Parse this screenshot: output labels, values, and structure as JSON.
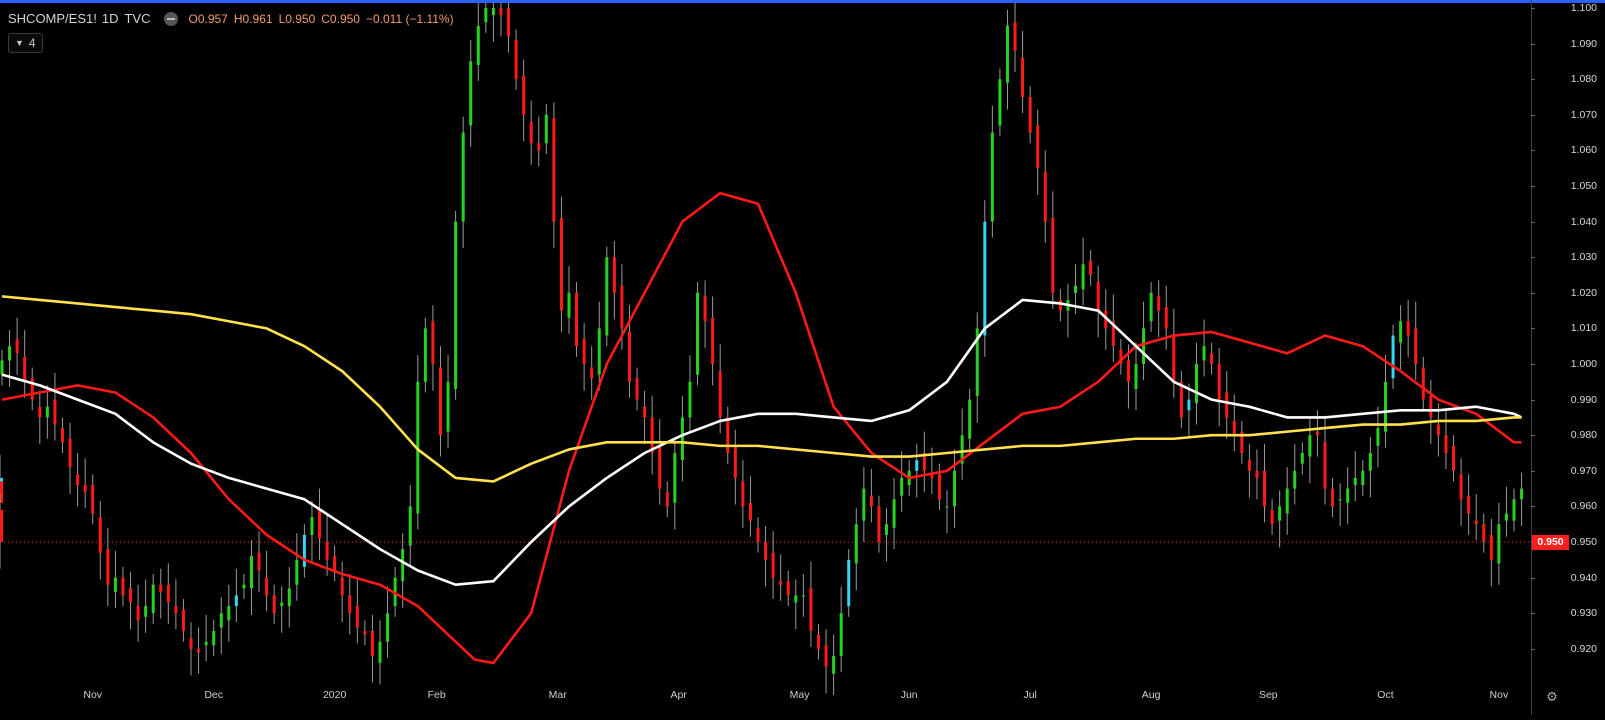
{
  "legend": {
    "symbol": "SHCOMP/ES1!",
    "interval": "1D",
    "source": "TVC",
    "open": "O0.957",
    "high": "H0.961",
    "low": "L0.950",
    "close": "C0.950",
    "change": "−0.011 (−1.11%)",
    "collapsed_count": "4"
  },
  "last_price_label": "0.950",
  "colors": {
    "background": "#000000",
    "up": "#25d31e",
    "down": "#ff1a1a",
    "up_hollow_cyan": "#33d6f5",
    "ma_red": "#ff1a1a",
    "ma_white": "#ffffff",
    "ma_yellow": "#ffe14d",
    "price_line": "#ff1a1a"
  },
  "icons": {
    "visibility": "eye-icon",
    "collapse": "chevron-down-icon",
    "settings": "gear-icon"
  },
  "chart_data": {
    "type": "line",
    "title": "SHCOMP/ES1!",
    "xlabel": "",
    "ylabel": "",
    "y_ticks": [
      "1.100",
      "1.090",
      "1.080",
      "1.070",
      "1.060",
      "1.050",
      "1.040",
      "1.030",
      "1.020",
      "1.010",
      "1.000",
      "0.990",
      "0.980",
      "0.970",
      "0.960",
      "0.950",
      "0.940",
      "0.930",
      "0.920"
    ],
    "x_ticks": [
      "Nov",
      "Dec",
      "2020",
      "Feb",
      "Mar",
      "Apr",
      "May",
      "Jun",
      "Jul",
      "Aug",
      "Sep",
      "Oct",
      "Nov"
    ],
    "ylim": [
      0.913,
      1.1
    ],
    "last_price": 0.95,
    "grid": false,
    "candles": {
      "x": [
        0,
        2,
        4,
        6,
        8,
        10,
        12,
        14,
        16,
        18,
        20,
        22,
        24,
        26,
        28,
        30,
        32,
        34,
        36,
        38,
        40,
        42,
        44,
        46,
        48,
        50,
        52,
        54,
        56,
        58,
        60,
        62,
        64,
        66,
        68,
        70,
        72,
        74,
        76,
        78,
        80,
        82,
        84,
        86,
        88,
        90,
        92,
        94,
        96,
        98,
        100,
        102,
        104,
        106,
        108,
        110,
        112,
        114,
        116,
        118,
        120,
        122,
        124,
        126,
        128,
        130,
        132,
        134,
        136,
        138,
        140,
        142,
        144,
        146,
        148,
        150,
        152,
        154,
        156,
        158,
        160,
        162,
        164,
        166,
        168,
        170,
        172,
        174,
        176,
        178,
        180,
        182,
        184,
        186,
        188,
        190,
        192,
        194,
        196,
        198,
        200,
        202,
        204,
        206,
        208,
        210,
        212,
        214,
        216,
        218,
        220,
        222,
        224,
        226,
        228,
        230,
        232,
        234,
        236,
        238,
        240,
        242,
        244,
        246,
        248,
        250,
        252,
        254,
        256,
        258,
        260,
        262,
        264,
        266,
        268,
        270,
        272,
        274,
        276,
        278,
        280,
        282,
        284,
        286,
        288,
        290,
        292,
        294,
        296,
        298,
        300,
        302,
        304,
        306,
        308,
        310,
        312,
        314,
        316,
        318,
        320,
        322,
        324,
        326,
        328,
        330,
        332,
        334,
        336,
        338,
        340,
        342,
        344,
        346,
        348,
        350,
        352,
        354,
        356,
        358,
        360,
        362,
        364,
        366,
        368,
        370,
        372,
        374,
        376,
        378,
        380,
        382,
        384,
        386,
        388,
        390,
        392,
        394,
        396,
        398,
        400,
        402
      ],
      "close": [
        1.001,
        1.005,
        1.003,
        0.995,
        0.99,
        0.985,
        0.988,
        0.983,
        0.978,
        0.971,
        0.966,
        0.964,
        0.958,
        0.947,
        0.938,
        0.94,
        0.935,
        0.933,
        0.928,
        0.932,
        0.938,
        0.936,
        0.933,
        0.93,
        0.925,
        0.92,
        0.919,
        0.922,
        0.925,
        0.93,
        0.932,
        0.935,
        0.938,
        0.946,
        0.942,
        0.935,
        0.93,
        0.933,
        0.937,
        0.945,
        0.952,
        0.957,
        0.951,
        0.945,
        0.942,
        0.935,
        0.93,
        0.926,
        0.924,
        0.918,
        0.922,
        0.93,
        0.94,
        0.948,
        0.96,
        0.995,
        1.01,
        1.0,
        0.98,
        0.995,
        1.04,
        1.065,
        1.085,
        1.095,
        1.1,
        1.1,
        1.098,
        1.092,
        1.08,
        1.07,
        1.062,
        1.06,
        1.07,
        1.04,
        1.015,
        1.02,
        1.005,
        1.0,
        0.996,
        1.01,
        1.03,
        1.02,
        1.01,
        0.995,
        0.99,
        0.985,
        0.975,
        0.965,
        0.96,
        0.975,
        0.985,
        0.995,
        1.02,
        1.012,
        1.0,
        0.985,
        0.975,
        0.968,
        0.96,
        0.956,
        0.95,
        0.945,
        0.94,
        0.938,
        0.935,
        0.935,
        0.935,
        0.925,
        0.92,
        0.915,
        0.918,
        0.93,
        0.945,
        0.955,
        0.965,
        0.96,
        0.95,
        0.955,
        0.962,
        0.968,
        0.97,
        0.973,
        0.97,
        0.968,
        0.962,
        0.96,
        0.97,
        0.98,
        0.99,
        1.01,
        1.04,
        1.065,
        1.08,
        1.095,
        1.088,
        1.075,
        1.065,
        1.055,
        1.04,
        1.02,
        1.015,
        1.018,
        1.022,
        1.028,
        1.025,
        1.015,
        1.01,
        1.005,
        1.0,
        0.995,
        1.0,
        1.01,
        1.02,
        1.015,
        1.01,
        0.995,
        0.985,
        0.99,
        1.0,
        1.005,
        1.0,
        0.99,
        0.985,
        0.98,
        0.975,
        0.97,
        0.968,
        0.96,
        0.955,
        0.96,
        0.965,
        0.97,
        0.975,
        0.98,
        0.98,
        0.965,
        0.96,
        0.962,
        0.965,
        0.968,
        0.97,
        0.975,
        0.982,
        0.995,
        1.008,
        1.012,
        1.008,
        1.0,
        0.99,
        0.985,
        0.98,
        0.975,
        0.97,
        0.962,
        0.958,
        0.955,
        0.95,
        0.945,
        0.955,
        0.958,
        0.962,
        0.965,
        0.968,
        0.966,
        0.961,
        0.95
      ]
    },
    "series": [
      {
        "color": "red",
        "x": [
          0,
          10,
          20,
          30,
          40,
          50,
          60,
          70,
          80,
          90,
          100,
          110,
          120,
          125,
          130,
          140,
          150,
          160,
          170,
          180,
          190,
          200,
          210,
          220,
          230,
          240,
          250,
          260,
          270,
          280,
          290,
          300,
          310,
          320,
          330,
          340,
          350,
          360,
          370,
          380,
          390,
          400,
          402
        ],
        "values": [
          0.99,
          0.992,
          0.994,
          0.992,
          0.985,
          0.975,
          0.962,
          0.952,
          0.945,
          0.941,
          0.938,
          0.932,
          0.922,
          0.917,
          0.916,
          0.93,
          0.97,
          1.0,
          1.02,
          1.04,
          1.048,
          1.045,
          1.02,
          0.988,
          0.975,
          0.968,
          0.97,
          0.978,
          0.986,
          0.988,
          0.995,
          1.005,
          1.008,
          1.009,
          1.006,
          1.003,
          1.008,
          1.005,
          0.998,
          0.99,
          0.986,
          0.978,
          0.978
        ]
      },
      {
        "color": "white",
        "x": [
          0,
          10,
          20,
          30,
          40,
          50,
          60,
          70,
          80,
          90,
          100,
          110,
          120,
          130,
          140,
          150,
          160,
          170,
          180,
          190,
          200,
          210,
          220,
          230,
          240,
          250,
          260,
          270,
          280,
          290,
          300,
          310,
          320,
          330,
          340,
          350,
          360,
          370,
          380,
          390,
          400,
          402
        ],
        "values": [
          0.997,
          0.994,
          0.99,
          0.986,
          0.978,
          0.972,
          0.968,
          0.965,
          0.962,
          0.955,
          0.948,
          0.942,
          0.938,
          0.939,
          0.95,
          0.96,
          0.968,
          0.975,
          0.98,
          0.984,
          0.986,
          0.986,
          0.985,
          0.984,
          0.987,
          0.995,
          1.01,
          1.018,
          1.017,
          1.015,
          1.005,
          0.995,
          0.99,
          0.988,
          0.985,
          0.985,
          0.986,
          0.987,
          0.987,
          0.988,
          0.986,
          0.985
        ]
      },
      {
        "color": "yellow",
        "x": [
          0,
          10,
          20,
          30,
          40,
          50,
          60,
          70,
          80,
          90,
          100,
          110,
          120,
          130,
          140,
          150,
          160,
          170,
          180,
          190,
          200,
          210,
          220,
          230,
          240,
          250,
          260,
          270,
          280,
          290,
          300,
          310,
          320,
          330,
          340,
          350,
          360,
          370,
          380,
          390,
          400,
          402
        ],
        "values": [
          1.019,
          1.018,
          1.017,
          1.016,
          1.015,
          1.014,
          1.012,
          1.01,
          1.005,
          0.998,
          0.988,
          0.976,
          0.968,
          0.967,
          0.972,
          0.976,
          0.978,
          0.978,
          0.978,
          0.977,
          0.977,
          0.976,
          0.975,
          0.974,
          0.974,
          0.975,
          0.976,
          0.977,
          0.977,
          0.978,
          0.979,
          0.979,
          0.98,
          0.98,
          0.981,
          0.982,
          0.983,
          0.983,
          0.984,
          0.984,
          0.985,
          0.985
        ]
      }
    ]
  }
}
